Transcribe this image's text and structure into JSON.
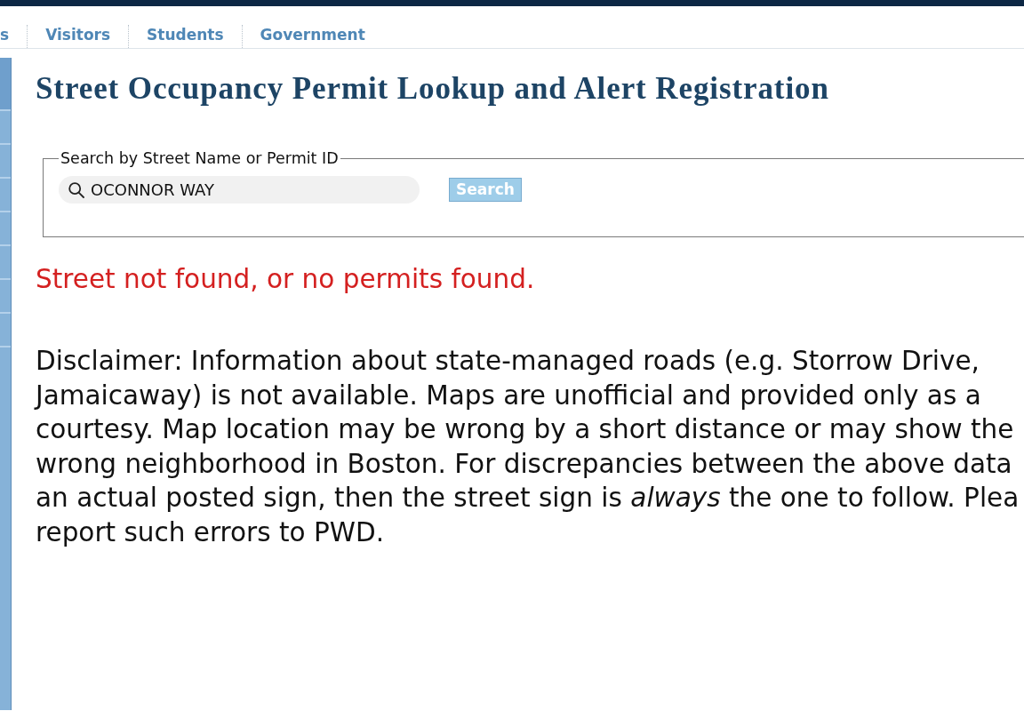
{
  "nav": {
    "links": [
      {
        "label": "s"
      },
      {
        "label": "Visitors"
      },
      {
        "label": "Students"
      },
      {
        "label": "Government"
      }
    ]
  },
  "page": {
    "title": "Street Occupancy Permit Lookup and Alert Registration"
  },
  "search": {
    "legend": "Search by Street Name or Permit ID",
    "value": "OCONNOR WAY",
    "button": "Search"
  },
  "message": "Street not found, or no permits found.",
  "disclaimer": {
    "lines": [
      "Disclaimer: Information about state-managed roads (e.g. Storrow Drive,",
      "Jamaicaway) is not available. Maps are unofficial and provided only as a",
      "courtesy. Map location may be wrong by a short distance or may show the",
      "wrong neighborhood in Boston. For discrepancies between the above data",
      "an actual posted sign, then the street sign is *always* the one to follow. Plea",
      "report such errors to PWD."
    ]
  }
}
